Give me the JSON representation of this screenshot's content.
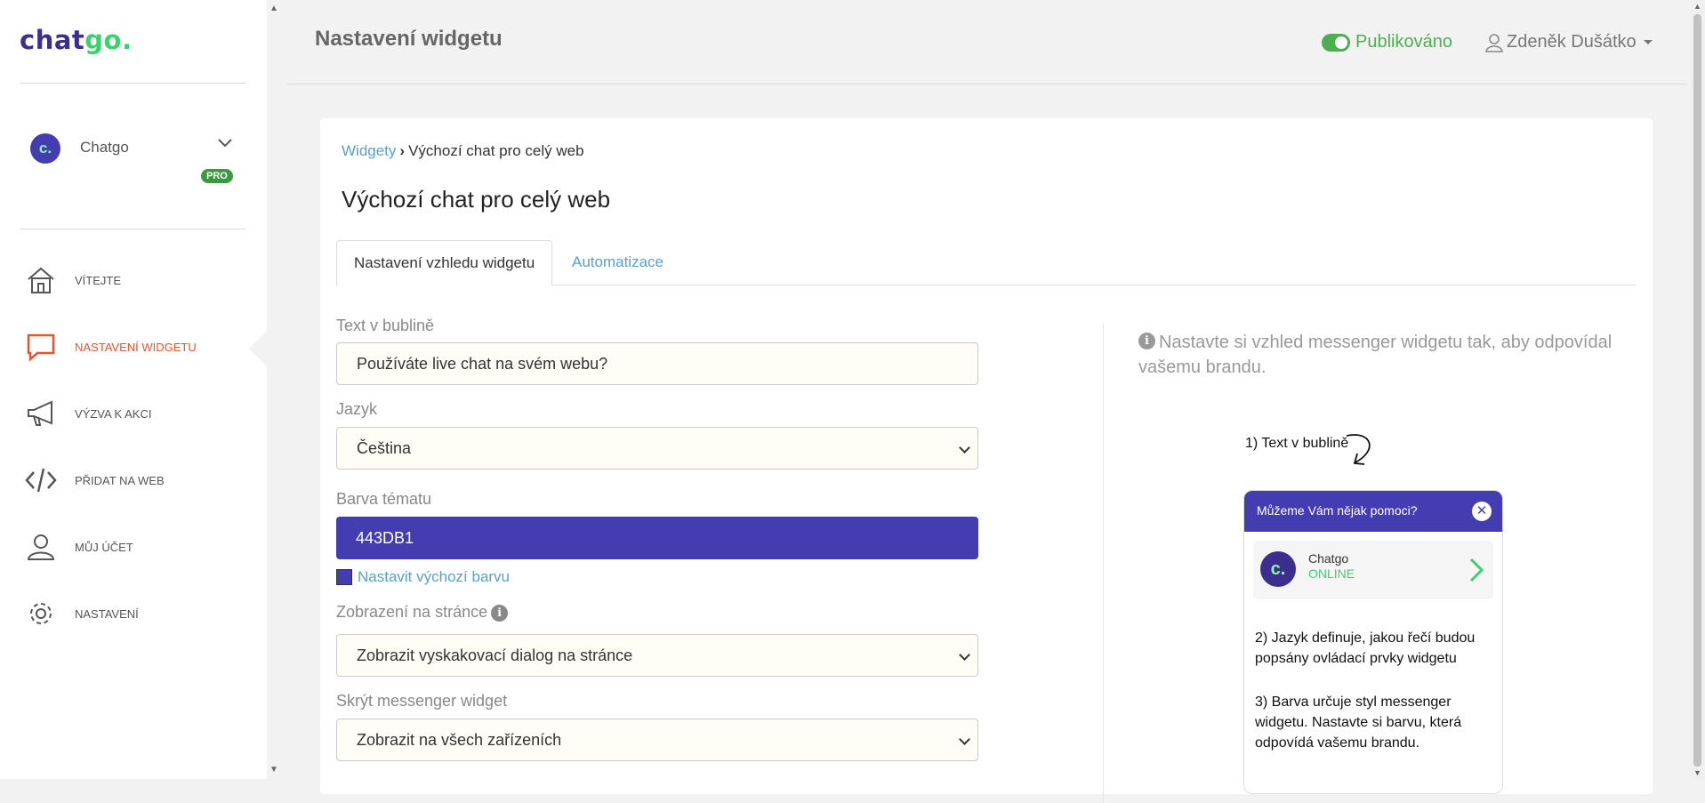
{
  "brand": {
    "chat": "chat",
    "go": "go",
    "dot": "."
  },
  "account": {
    "avatar_letter": "c.",
    "name": "Chatgo",
    "badge": "PRO"
  },
  "nav": {
    "items": [
      {
        "label": "VÍTEJTE",
        "icon": "home-icon"
      },
      {
        "label": "NASTAVENÍ WIDGETU",
        "icon": "chat-icon"
      },
      {
        "label": "VÝZVA K AKCI",
        "icon": "megaphone-icon"
      },
      {
        "label": "PŘIDAT NA WEB",
        "icon": "code-icon"
      },
      {
        "label": "MŮJ ÚČET",
        "icon": "user-icon"
      },
      {
        "label": "NASTAVENÍ",
        "icon": "gear-icon"
      }
    ],
    "active_index": 1
  },
  "header": {
    "title": "Nastavení widgetu",
    "status": "Publikováno",
    "user": "Zdeněk Dušátko"
  },
  "breadcrumb": {
    "parent": "Widgety",
    "separator": "›",
    "current": "Výchozí chat pro celý web"
  },
  "card": {
    "title": "Výchozí chat pro celý web"
  },
  "tabs": [
    {
      "label": "Nastavení vzhledu widgetu"
    },
    {
      "label": "Automatizace"
    }
  ],
  "form": {
    "bubble_label": "Text v bublině",
    "bubble_value": "Používáte live chat na svém webu?",
    "lang_label": "Jazyk",
    "lang_value": "Čeština",
    "color_label": "Barva tématu",
    "color_value": "443DB1",
    "color_reset": "Nastavit výchozí barvu",
    "display_label": "Zobrazení na stránce",
    "display_value": "Zobrazit vyskakovací dialog na stránce",
    "hide_label": "Skrýt messenger widget",
    "hide_value": "Zobrazit na všech zařízeních"
  },
  "help": {
    "text": "Nastavte si vzhled messenger widgetu tak, aby odpovídal vašemu brandu."
  },
  "preview": {
    "note1": "1) Text v bublině",
    "header": "Můžeme Vám nějak pomoci?",
    "agent": "Chatgo",
    "status": "ONLINE",
    "note2": "2) Jazyk definuje, jakou řečí budou popsány ovládací prvky widgetu",
    "note3": "3) Barva určuje styl messenger widgetu. Nastavte si barvu, která odpovídá vašemu brandu."
  },
  "colors": {
    "theme": "#443db1",
    "accent_green": "#4caf50",
    "active_nav": "#e8542b",
    "link": "#5aa0c8"
  }
}
